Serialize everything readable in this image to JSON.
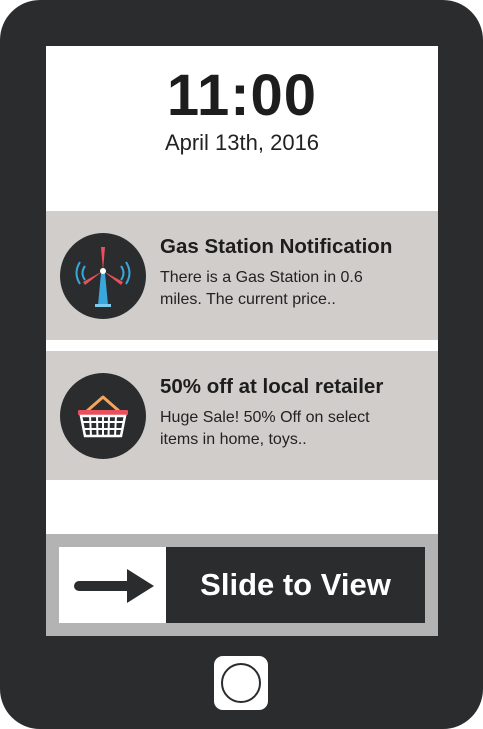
{
  "lock_screen": {
    "time": "11:00",
    "date": "April 13th, 2016"
  },
  "notifications": [
    {
      "icon": "wind-turbine-icon",
      "title": "Gas Station Notification",
      "body": "There is a Gas Station in 0.6 miles. The current price.."
    },
    {
      "icon": "shopping-basket-icon",
      "title": "50% off at local retailer",
      "body": "Huge Sale! 50% Off on select items in home, toys.."
    }
  ],
  "slider": {
    "label": "Slide to View",
    "icon": "arrow-right-icon"
  },
  "hardware": {
    "home_button_icon": "home-button-icon"
  },
  "colors": {
    "device_body": "#2a2c2e",
    "notification_bg": "#d1cdcb",
    "slider_frame": "#b3b3b3",
    "turbine_blade": "#e8505b",
    "turbine_tower": "#3aa7dc",
    "basket_handle": "#f2a65a",
    "basket_body": "#ffffff"
  }
}
